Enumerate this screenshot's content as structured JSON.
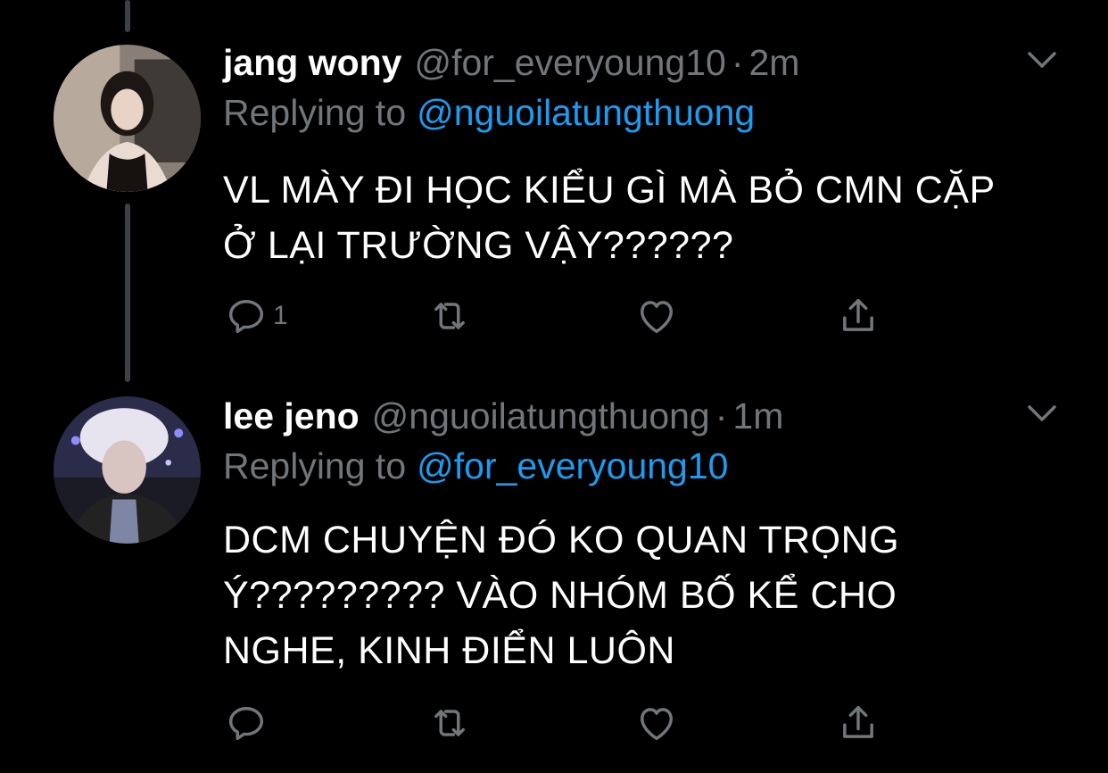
{
  "tweets": [
    {
      "name": "jang wony",
      "handle": "@for_everyoung10",
      "separator": "·",
      "time": "2m",
      "replying_prefix": "Replying to",
      "replying_to": "@nguoilatungthuong",
      "text_lines": [
        "VL MÀY ĐI HỌC KIỂU GÌ MÀ BỎ CMN CẶP",
        "Ở LẠI TRƯỜNG VẬY??????"
      ],
      "reply_count": "1",
      "avatar_icon": "avatar-photo"
    },
    {
      "name": "lee jeno",
      "handle": "@nguoilatungthuong",
      "separator": "·",
      "time": "1m",
      "replying_prefix": "Replying to",
      "replying_to": "@for_everyoung10",
      "text_lines": [
        "DCM CHUYỆN ĐÓ KO QUAN TRỌNG",
        "Ý????????? VÀO NHÓM BỐ KỂ CHO",
        "NGHE, KINH ĐIỂN LUÔN"
      ],
      "reply_count": "",
      "avatar_icon": "avatar-photo"
    }
  ],
  "icons": {
    "reply": "reply-icon",
    "retweet": "retweet-icon",
    "like": "heart-icon",
    "share": "share-icon",
    "more": "chevron-down-icon"
  },
  "colors": {
    "background": "#000000",
    "secondary_text": "#71767b",
    "mention": "#1d9bf0",
    "thread_line": "#3d4145"
  }
}
